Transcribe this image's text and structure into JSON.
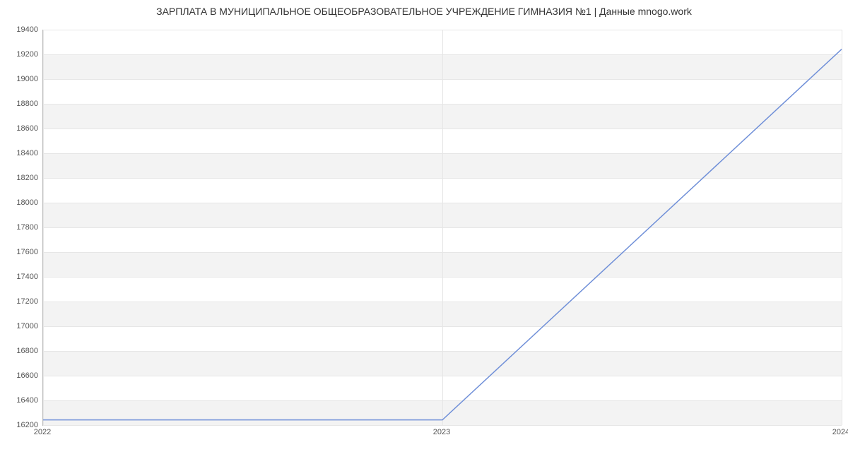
{
  "chart_data": {
    "type": "line",
    "title": "ЗАРПЛАТА В МУНИЦИПАЛЬНОЕ ОБЩЕОБРАЗОВАТЕЛЬНОЕ УЧРЕЖДЕНИЕ ГИМНАЗИЯ №1 | Данные mnogo.work",
    "x": [
      "2022",
      "2023",
      "2024"
    ],
    "values": [
      16242,
      16242,
      19242
    ],
    "xlabel": "",
    "ylabel": "",
    "xlim": [
      2022,
      2024
    ],
    "ylim": [
      16200,
      19400
    ],
    "y_ticks": [
      16200,
      16400,
      16600,
      16800,
      17000,
      17200,
      17400,
      17600,
      17800,
      18000,
      18200,
      18400,
      18600,
      18800,
      19000,
      19200,
      19400
    ],
    "x_ticks": [
      "2022",
      "2023",
      "2024"
    ],
    "grid": true,
    "line_color": "#6f8fd8"
  }
}
